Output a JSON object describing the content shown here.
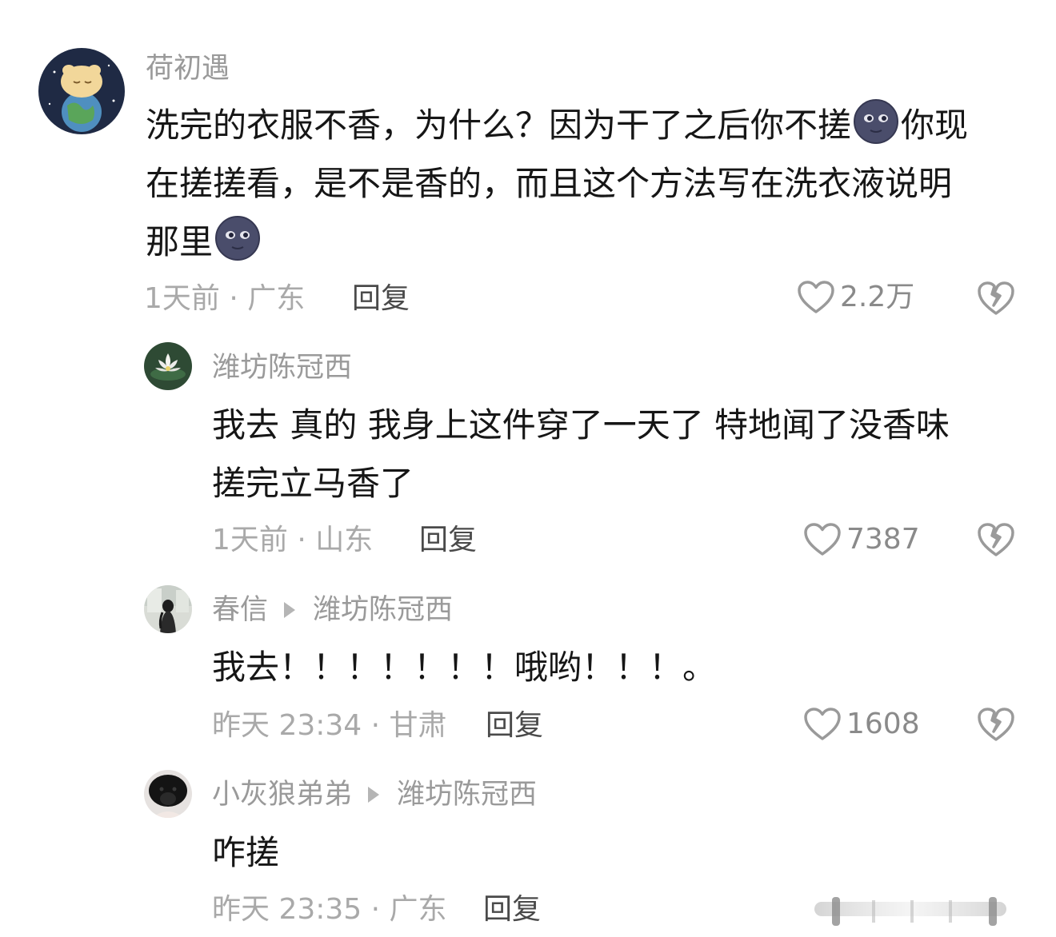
{
  "comments": [
    {
      "username": "荷初遇",
      "text_line1a": "洗完的衣服不香，为什么？因为干了之后你不搓",
      "text_line1b": "你现",
      "text_line2": "在搓搓看，是不是香的，而且这个方法写在洗衣液说明",
      "text_line3": "那里",
      "emoji": "new-moon-face-icon",
      "meta": "1天前 · 广东",
      "reply_label": "回复",
      "likes": "2.2万"
    },
    {
      "username": "潍坊陈冠西",
      "text_line1": "我去 真的  我身上这件穿了一天了 特地闻了没香味",
      "text_line2": "搓完立马香了",
      "meta": "1天前 · 山东",
      "reply_label": "回复",
      "likes": "7387"
    },
    {
      "username": "春信",
      "reply_to": "潍坊陈冠西",
      "text_line1": "我去！！！！！！！哦哟！！！。",
      "meta": "昨天 23:34 · 甘肃",
      "reply_label": "回复",
      "likes": "1608"
    },
    {
      "username": "小灰狼弟弟",
      "reply_to": "潍坊陈冠西",
      "text_line1": "咋搓",
      "meta": "昨天 23:35 · 广东",
      "reply_label": "回复"
    }
  ],
  "colors": {
    "username": "#9a9a9a",
    "text": "#161616",
    "meta": "#a9a9a9",
    "icon": "#9a9a9a"
  }
}
